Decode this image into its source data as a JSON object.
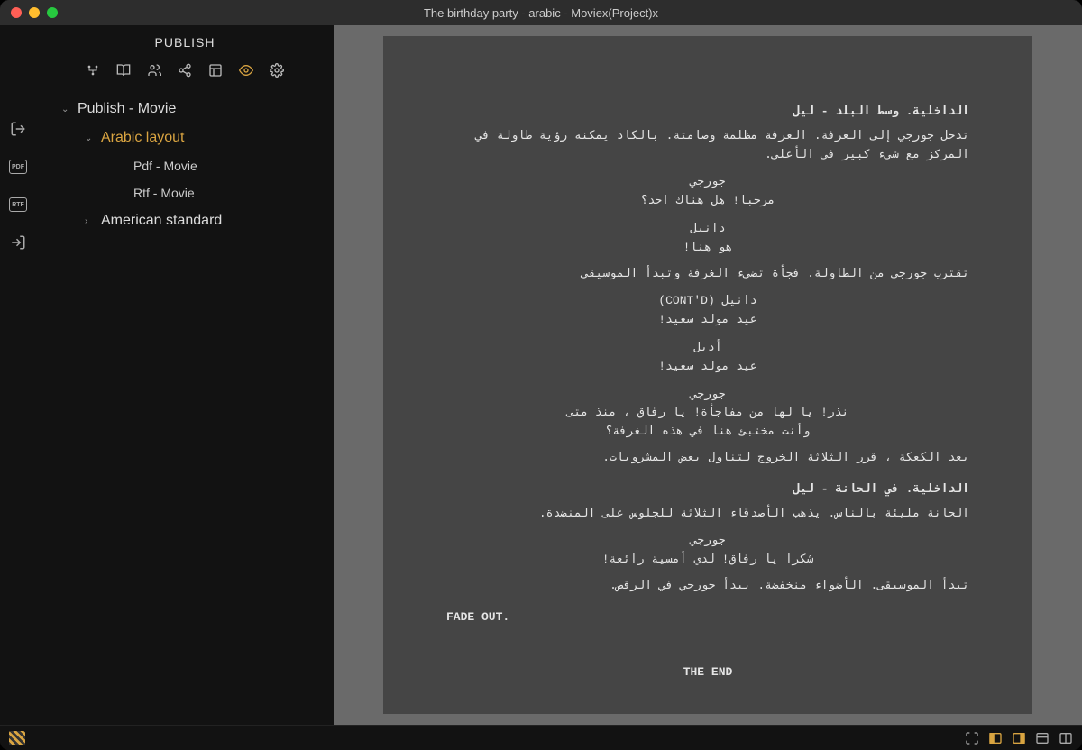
{
  "window": {
    "title": "The birthday party - arabic - Moviex(Project)x"
  },
  "sidebar": {
    "header": "PUBLISH",
    "tree": {
      "root": "Publish - Movie",
      "arabic": "Arabic layout",
      "pdf": "Pdf - Movie",
      "rtf": "Rtf - Movie",
      "american": "American standard"
    }
  },
  "rail": {
    "pdf": "PDF",
    "rtf": "RTF"
  },
  "script": {
    "scene1": "الداخلية. وسط البلد - ليل",
    "action1": "تدخل جورجي إلى الغرفة. الغرفة مظلمة وصامتة. بالكاد يمكنه رؤية طاولة في المركز مع شيء كبير في الأعلى.",
    "char_giorgi1": "جورجي",
    "dlg_giorgi1": "مرحبا! هل هناك احد؟",
    "char_daniel1": "دانيل",
    "dlg_daniel1": "هو هنا!",
    "action2": "تقترب جورجي من الطاولة. فجأة تضيء الغرفة وتبدأ الموسيقى",
    "char_daniel2": "دانيل (CONT'D)",
    "dlg_daniel2": "عيد مولد سعيد!",
    "char_adele": "أديل",
    "dlg_adele": "عيد مولد سعيد!",
    "char_giorgi2": "جورجي",
    "dlg_giorgi2": "نذر! يا لها من مفاجأة! يا رفاق ، منذ متى وأنت مختبئ هنا في هذه الغرفة؟",
    "action3": "بعد الكعكة ، قرر الثلاثة الخروج لتناول بعض المشروبات.",
    "scene2": "الداخلية. في الحانة - ليل",
    "action4": "الحانة مليئة بالناس. يذهب الأصدقاء الثلاثة للجلوس على المنضدة.",
    "char_giorgi3": "جورجي",
    "dlg_giorgi3": "شكرا يا رفاق! لدي أمسية رائعة!",
    "action5": "تبدأ الموسيقى. الأضواء منخفضة. يبدأ جورجي في الرقص.",
    "fadeout": "FADE OUT.",
    "theend": "THE END"
  }
}
